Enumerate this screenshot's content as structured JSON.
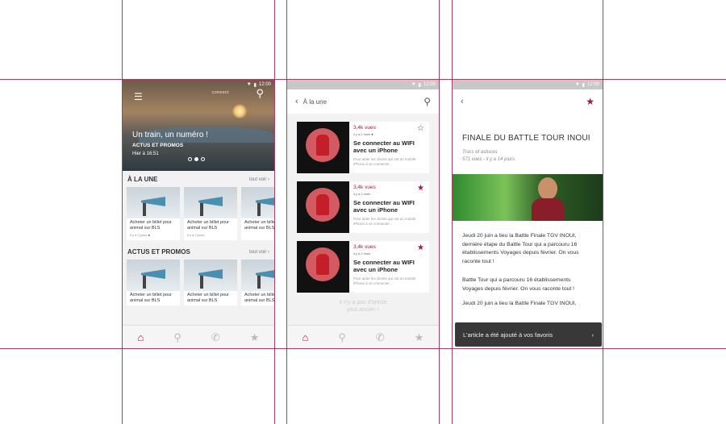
{
  "status_time": "12:00",
  "tabs": [
    "home-icon",
    "search-icon",
    "phone-icon",
    "star-icon"
  ],
  "screen1": {
    "hero": {
      "logo": "connect",
      "title": "Un train, un numéro !",
      "category": "ACTUS ET PROMOS",
      "date": "Hier à 16:51"
    },
    "sections": [
      {
        "title": "À LA UNE",
        "link": "tout voir ›",
        "cards": [
          {
            "title": "Acheter un billet pour animal sur BLS",
            "ago": "il y a 2 jours"
          },
          {
            "title": "Acheter un billet pour animal sur BLS",
            "ago": "il y a 2 jours"
          },
          {
            "title": "Acheter un billet pour animal sur BLS",
            "ago": ""
          }
        ]
      },
      {
        "title": "ACTUS ET PROMOS",
        "link": "tout voir ›",
        "cards": [
          {
            "title": "Acheter un billet pour animal sur BLS",
            "ago": ""
          },
          {
            "title": "Acheter un billet pour animal sur BLS",
            "ago": ""
          },
          {
            "title": "Acheter un billet pour animal sur BLS",
            "ago": ""
          }
        ]
      }
    ]
  },
  "screen2": {
    "header": "À la une",
    "articles": [
      {
        "views": "3,4k vues",
        "ago": "il y a 2 mois",
        "title": "Se connecter au WIFI avec un iPhone",
        "excerpt": "Pour aider les clients qui ont un mobile iPhone à se connecter...",
        "favorite": false
      },
      {
        "views": "3,4k vues",
        "ago": "il y a 2 mois",
        "title": "Se connecter au WIFI avec un iPhone",
        "excerpt": "Pour aider les clients qui ont un mobile iPhone à se connecter...",
        "favorite": true
      },
      {
        "views": "3,4k vues",
        "ago": "il y a 2 mois",
        "title": "Se connecter au WIFI avec un iPhone",
        "excerpt": "Pour aider les clients qui ont un mobile iPhone à se connecter...",
        "favorite": true
      }
    ],
    "empty_line1": "Il n'y a pas d'article",
    "empty_line2": "plus ancien !"
  },
  "screen3": {
    "title": "FINALE DU BATTLE TOUR INOUI",
    "category": "Trucs et astuces",
    "meta": "571 vues - il y a 14 jours",
    "paragraph1": "Jeudi 20 juin a lieu la Battle Finale TGV INOUI, dernière étape du Battle Tour qui a parcouru 16 établissements Voyages depuis février. On vous raconte tout !",
    "paragraph2": "Battle Tour qui a parcouru 16 établissements Voyages depuis février. On vous raconte tout !",
    "paragraph3": "Jeudi 20 juin a lieu la Battle Finale TGV INOUI,",
    "toast": "L'article a été ajouté à vos favoris"
  },
  "colors": {
    "accent": "#9e1b45",
    "guide": "#9e1b45"
  }
}
